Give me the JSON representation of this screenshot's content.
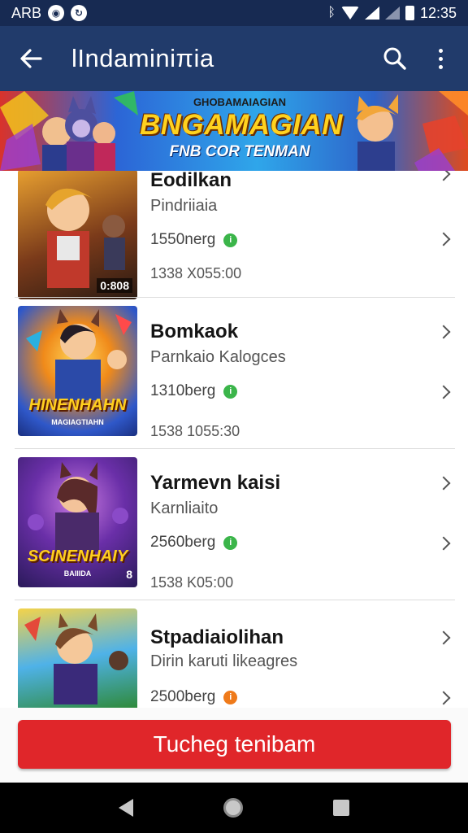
{
  "status_bar": {
    "carrier": "ARB",
    "time": "12:35"
  },
  "app_bar": {
    "title": "lIndaminiπia",
    "back_icon": "arrow-left-icon",
    "search_icon": "search-icon",
    "more_icon": "more-vert-icon"
  },
  "banner": {
    "subtitle": "GHOBAMAIAGIAN",
    "title": "BNGAMAGIAN",
    "tagline": "FNB COR TENMAN"
  },
  "games": [
    {
      "title": "Eodilkan",
      "subtitle": "Pindriiaia",
      "stat": "1550nerg",
      "badge": "0:808",
      "time": "1338 X055:00",
      "status_color": "#3bb54a"
    },
    {
      "title": "Bomkaok",
      "subtitle": "Parnkaio Kalogces",
      "stat": "1310berg",
      "caption": "HINENHAHN",
      "caption_sub": "MAGIAGTIAHN",
      "time": "1538 1055:30",
      "status_color": "#3bb54a"
    },
    {
      "title": "Yarmevn kaisi",
      "subtitle": "Karnliaito",
      "stat": "2560berg",
      "caption": "SCINENHAIY",
      "caption_sub": "BAIIIDA",
      "badge": "8",
      "time": "1538 K05:00",
      "status_color": "#3bb54a"
    },
    {
      "title": "Stpadiaiolihan",
      "subtitle": "Dirin karuti likeagres",
      "stat": "2500berg",
      "time": "",
      "status_color": "#ef7a1a"
    }
  ],
  "cta": {
    "label": "Tucheg tenibam"
  },
  "colors": {
    "app_bar": "#213b6b",
    "status_bar": "#172a52",
    "accent_red": "#e0262a"
  }
}
